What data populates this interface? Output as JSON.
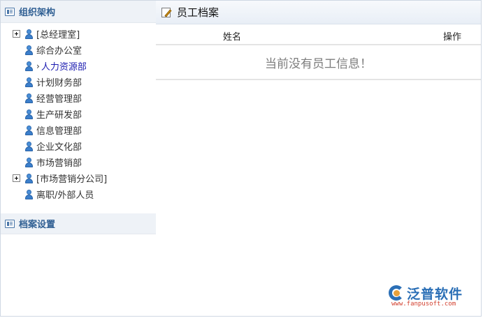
{
  "sidebar": {
    "org_title": "组织架构",
    "tree": [
      {
        "label": "[总经理室]",
        "expandable": true
      },
      {
        "label": "综合办公室",
        "expandable": false
      },
      {
        "label": "人力资源部",
        "expandable": false,
        "active": true
      },
      {
        "label": "计划财务部",
        "expandable": false
      },
      {
        "label": "经营管理部",
        "expandable": false
      },
      {
        "label": "生产研发部",
        "expandable": false
      },
      {
        "label": "信息管理部",
        "expandable": false
      },
      {
        "label": "企业文化部",
        "expandable": false
      },
      {
        "label": "市场营销部",
        "expandable": false
      },
      {
        "label": "[市场营销分公司]",
        "expandable": true
      },
      {
        "label": "离职/外部人员",
        "expandable": false
      }
    ],
    "settings_title": "档案设置"
  },
  "main": {
    "title": "员工档案",
    "columns": {
      "name": "姓名",
      "action": "操作"
    },
    "empty_message": "当前没有员工信息！"
  },
  "logo": {
    "brand": "泛普软件",
    "url": "www.fanpusoft.com"
  },
  "colors": {
    "accent": "#2f5f93",
    "active_link": "#1b1bb0",
    "brand_blue": "#2b6fb6",
    "brand_red": "#d2402f"
  }
}
